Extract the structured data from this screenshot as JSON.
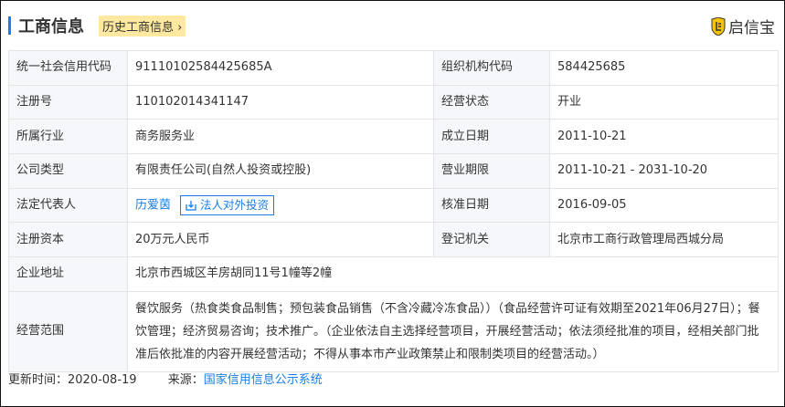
{
  "header": {
    "title": "工商信息",
    "history_label": "历史工商信息",
    "logo_text": "启信宝"
  },
  "rows": [
    {
      "l1": "统一社会信用代码",
      "v1": "91110102584425685A",
      "l2": "组织机构代码",
      "v2": "584425685"
    },
    {
      "l1": "注册号",
      "v1": "110102014341147",
      "l2": "经营状态",
      "v2": "开业"
    },
    {
      "l1": "所属行业",
      "v1": "商务服务业",
      "l2": "成立日期",
      "v2": "2011-10-21"
    },
    {
      "l1": "公司类型",
      "v1": "有限责任公司(自然人投资或控股)",
      "l2": "营业期限",
      "v2": "2011-10-21 - 2031-10-20"
    },
    {
      "l1": "法定代表人",
      "v1": "历爱茵",
      "btn": "法人对外投资",
      "l2": "核准日期",
      "v2": "2016-09-05"
    },
    {
      "l1": "注册资本",
      "v1": "20万元人民币",
      "l2": "登记机关",
      "v2": "北京市工商行政管理局西城分局"
    }
  ],
  "address": {
    "label": "企业地址",
    "value": "北京市西城区羊房胡同11号1幢等2幢"
  },
  "scope": {
    "label": "经营范围",
    "value": "餐饮服务（热食类食品制售；预包装食品销售（不含冷藏冷冻食品））（食品经营许可证有效期至2021年06月27日）；餐饮管理；经济贸易咨询；技术推广。（企业依法自主选择经营项目，开展经营活动；依法须经批准的项目，经相关部门批准后依批准的内容开展经营活动；不得从事本市产业政策禁止和限制类项目的经营活动。）"
  },
  "footer": {
    "updated_label": "更新时间：",
    "updated": "2020-08-19",
    "source_label": "来源：",
    "source": "国家信用信息公示系统"
  }
}
